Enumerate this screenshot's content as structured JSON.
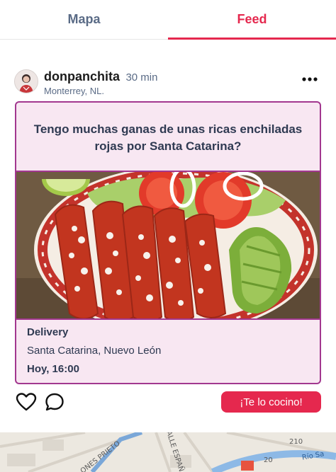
{
  "tabs": [
    {
      "label": "Mapa",
      "active": false
    },
    {
      "label": "Feed",
      "active": true
    }
  ],
  "post": {
    "author": "donpanchita",
    "time": "30 min",
    "location": "Monterrey, NL.",
    "question": "Tengo muchas ganas de unas ricas enchiladas rojas por Santa Catarina?",
    "image_icon": "enchiladas-photo",
    "details": {
      "delivery": "Delivery",
      "place": "Santa Catarina, Nuevo León",
      "when": "Hoy, 16:00"
    },
    "cta_label": "¡Te lo cocino!"
  },
  "map": {
    "labels": [
      "ONES PRIETO",
      "CALLE ESPAÑ",
      "210",
      "20",
      "Río Sa"
    ]
  },
  "colors": {
    "accent": "#e5284e",
    "card_border": "#a2378f",
    "card_bg": "#f8e7f2",
    "muted_text": "#5a6b86"
  }
}
